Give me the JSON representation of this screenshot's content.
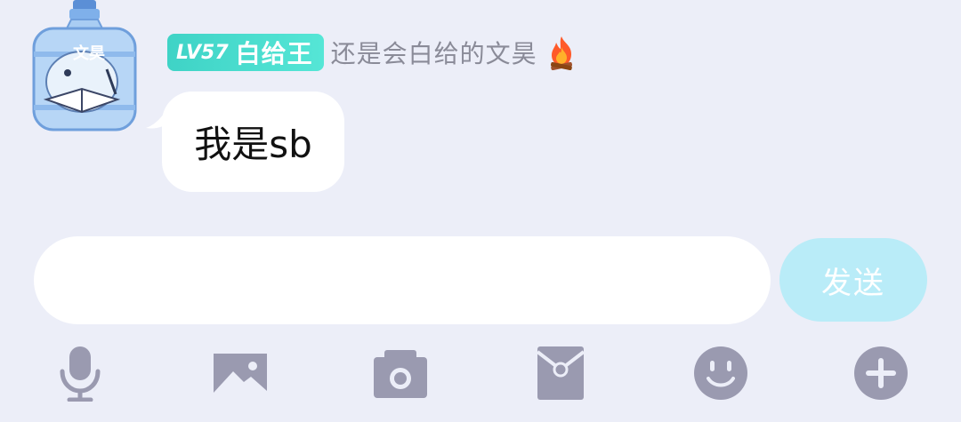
{
  "sender": {
    "avatar_label": "文昊",
    "level": "LV57",
    "title": "白给王",
    "nickname": "还是会白给的文昊",
    "flair_icon": "fire-icon"
  },
  "message": {
    "text": "我是sb"
  },
  "composer": {
    "input_value": "",
    "send_label": "发送"
  },
  "toolbar": {
    "items": [
      "microphone-icon",
      "image-icon",
      "camera-icon",
      "red-envelope-icon",
      "emoji-icon",
      "plus-icon"
    ]
  },
  "colors": {
    "background": "#eceef8",
    "badge": "#3fd3c6",
    "send_button": "#b9ecf8",
    "icon_gray": "#9a9ab0"
  }
}
